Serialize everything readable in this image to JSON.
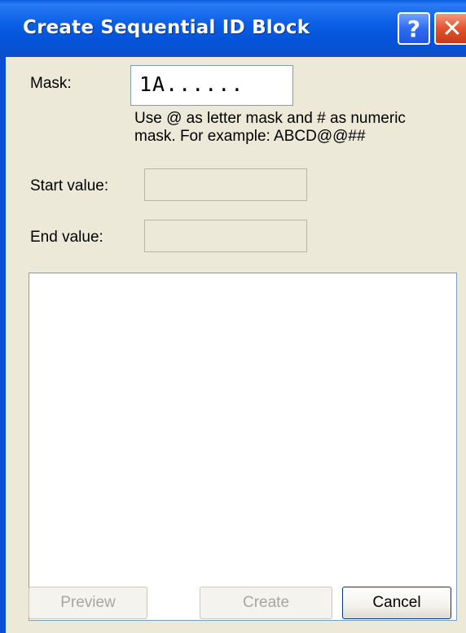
{
  "window": {
    "title": "Create Sequential ID Block",
    "help_glyph": "?",
    "close_glyph": "✕"
  },
  "form": {
    "mask_label": "Mask:",
    "mask_value": "1A......",
    "mask_hint_line1": "Use @ as letter mask and # as numeric",
    "mask_hint_line2": "mask. For example: ABCD@@##",
    "start_label": "Start value:",
    "start_value": "",
    "end_label": "End value:",
    "end_value": ""
  },
  "buttons": {
    "preview": "Preview",
    "create": "Create",
    "cancel": "Cancel"
  },
  "colors": {
    "titlebar": "#0553d8",
    "dialog_bg": "#ece9d8",
    "close_button": "#e2532f"
  }
}
